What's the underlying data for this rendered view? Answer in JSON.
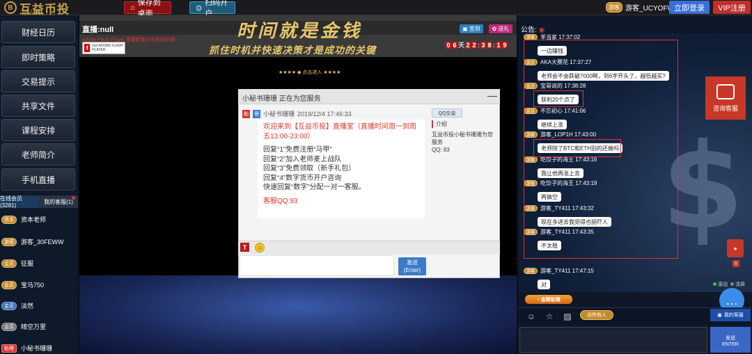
{
  "top": {
    "logo_mark": "B",
    "logo_name": "互益币投",
    "logo_sub": "MUTUAL INVESTMENT",
    "save_desktop": "保存到桌面",
    "scan_open": "扫码开户",
    "guest_badge": "游客",
    "guest_name": "游客_UCYOFW",
    "login": "立即登录",
    "vip": "VIP注册"
  },
  "nav": [
    "财经日历",
    "即时策略",
    "交易提示",
    "共享文件",
    "课程安排",
    "老师简介",
    "手机直播"
  ],
  "member_tabs": {
    "online": "在线会员 (3281)",
    "mine": "我的客服(1)"
  },
  "members": [
    {
      "badge": "资本",
      "name": "资本老师"
    },
    {
      "badge": "游客",
      "name": "游客_30FEWW"
    },
    {
      "badge": "会员",
      "name": "征服"
    },
    {
      "badge": "会员",
      "name": "宝马750"
    },
    {
      "badge": "会员",
      "name": "淡然"
    },
    {
      "badge": "会员",
      "name": "晴空万里"
    },
    {
      "badge": "助理",
      "name": "小秘书珊珊"
    }
  ],
  "live": {
    "title": "直播:null",
    "flash_note": "Adobe Flash Player 需要新版点击获取安装！",
    "flash_f": "f",
    "flash_text": "Get ADOBE FLASH PLAYER",
    "sign": "签到",
    "gift": "送礼",
    "countdown": [
      {
        "t": "0",
        "u": false
      },
      {
        "t": "6",
        "u": false
      },
      {
        "t": "天",
        "u": true
      },
      {
        "t": "2",
        "u": false
      },
      {
        "t": "2",
        "u": false
      },
      {
        "t": ":",
        "u": true
      },
      {
        "t": "3",
        "u": false
      },
      {
        "t": "8",
        "u": false
      },
      {
        "t": ":",
        "u": true
      },
      {
        "t": "1",
        "u": false
      },
      {
        "t": "9",
        "u": false
      }
    ]
  },
  "banner": {
    "title": "时间就是金钱",
    "sub": "抓住时机并快速决策才是成功的关键",
    "enter": "★★★★  ◆ 点击进入  ★★★★"
  },
  "popup": {
    "header": "小秘书珊珊 正在为您服务",
    "min": "—",
    "badge1": "助",
    "badge2": "理",
    "sender": "小秘书珊珊",
    "time": "2019/12/4 17:46:33",
    "welcome": "欢迎来到【互益币投】直播室（直播时间周一到周五13:00-23:00）",
    "lines": [
      "回复“1”免费注册“马甲”",
      "回复“2”加入老师麦上战队",
      "回复“3”免费领取（新手礼包）",
      "回复“4”数字货币开户咨询",
      "快速回复“数字”分配一对一客服。"
    ],
    "qq_line": "客服QQ:93",
    "side_qq": "QQ交谈",
    "side_intro": "介绍",
    "side_desc": "互益币投小秘书珊珊为您服务",
    "side_qq_num": "QQ: 93",
    "font_icon": "T",
    "send": "发送",
    "send_sub": "(Enter)"
  },
  "chat": {
    "notice_label": "公告:",
    "messages": [
      {
        "badge": "游客",
        "meta": "羊当家 17:37:02",
        "text": "一边赚钱"
      },
      {
        "badge": "会员",
        "meta": "AKA大赛花 17:37:27",
        "text": "老师会不会跌破7000啊，到6字开头了，越低越买?"
      },
      {
        "badge": "会员",
        "meta": "宝哥说的 17:38:28",
        "text": "获利20个点了"
      },
      {
        "badge": "会员",
        "meta": "不忘初心 17:41:06",
        "text": "继续上涨"
      },
      {
        "badge": "游客",
        "meta": "游客_LOP1H 17:43:00",
        "text": "老师除了BTC和ETH别的还做吗"
      },
      {
        "badge": "游客",
        "meta": "吃饺子的海王 17:43:16",
        "text": "我让他再涨上去"
      },
      {
        "badge": "游客",
        "meta": "吃饺子的海王 17:43:19",
        "text": "再做空"
      },
      {
        "badge": "游客",
        "meta": "游客_TY411 17:43:32",
        "text": "现在多进去我觉得也挺吓人"
      },
      {
        "badge": "游客",
        "meta": "游客_TY411 17:43:35",
        "text": "不太稳"
      },
      {
        "badge": "游客",
        "meta": "游客_TY411 17:47:15",
        "text": "对"
      }
    ],
    "consult": "咨询客服",
    "float_count": "0",
    "scroll": "滚动",
    "clear": "清屏",
    "gold": "金牌助理",
    "to_all": "@所有人",
    "my_service": "我的客服",
    "send": "发送",
    "send_sub": "ENTER"
  }
}
